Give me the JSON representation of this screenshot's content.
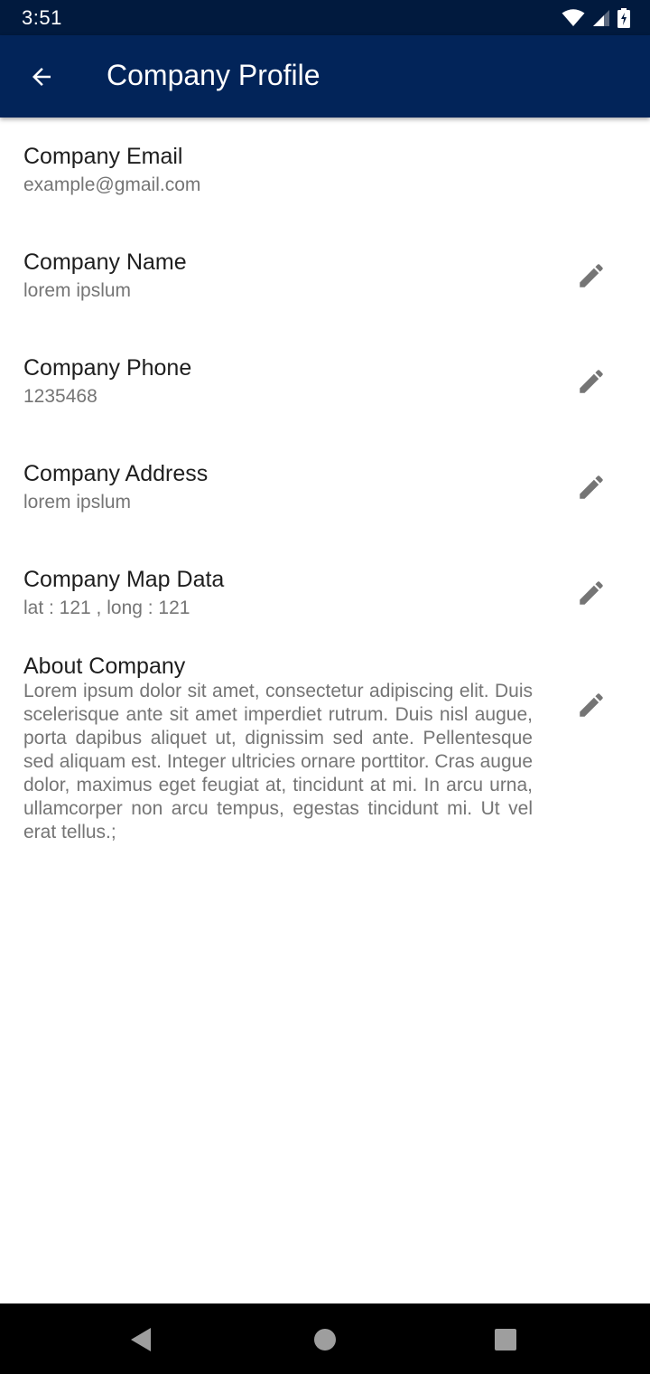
{
  "status_bar": {
    "time": "3:51",
    "icons": [
      "wifi-icon",
      "cell-signal-icon",
      "battery-charging-icon"
    ]
  },
  "app_bar": {
    "title": "Company Profile",
    "back_icon": "arrow-back-icon"
  },
  "fields": {
    "email": {
      "label": "Company Email",
      "value": "example@gmail.com"
    },
    "name": {
      "label": "Company Name",
      "value": "lorem ipslum"
    },
    "phone": {
      "label": "Company Phone",
      "value": "1235468"
    },
    "address": {
      "label": "Company Address",
      "value": "lorem ipslum"
    },
    "map": {
      "label": "Company Map Data",
      "value": "lat : 121 , long : 121"
    },
    "about": {
      "label": "About Company",
      "value": "Lorem ipsum dolor sit amet, consectetur adipiscing elit. Duis scelerisque ante sit amet imperdiet rutrum. Duis nisl augue, porta dapibus aliquet ut, dignissim sed ante. Pellentesque sed aliquam est. Integer ultricies ornare porttitor. Cras augue dolor, maximus eget feugiat at, tincidunt at mi. In arcu urna, ullamcorper non arcu tempus, egestas tincidunt mi. Ut vel erat tellus.;"
    }
  },
  "edit_icon": "pencil-icon",
  "nav_bar": {
    "back": "nav-back-icon",
    "home": "nav-home-icon",
    "recents": "nav-recents-icon"
  },
  "colors": {
    "status_bar": "#011a3e",
    "app_bar": "#022459",
    "label_text": "#1e1e1e",
    "value_text": "#757575",
    "edit_icon": "#757575"
  }
}
